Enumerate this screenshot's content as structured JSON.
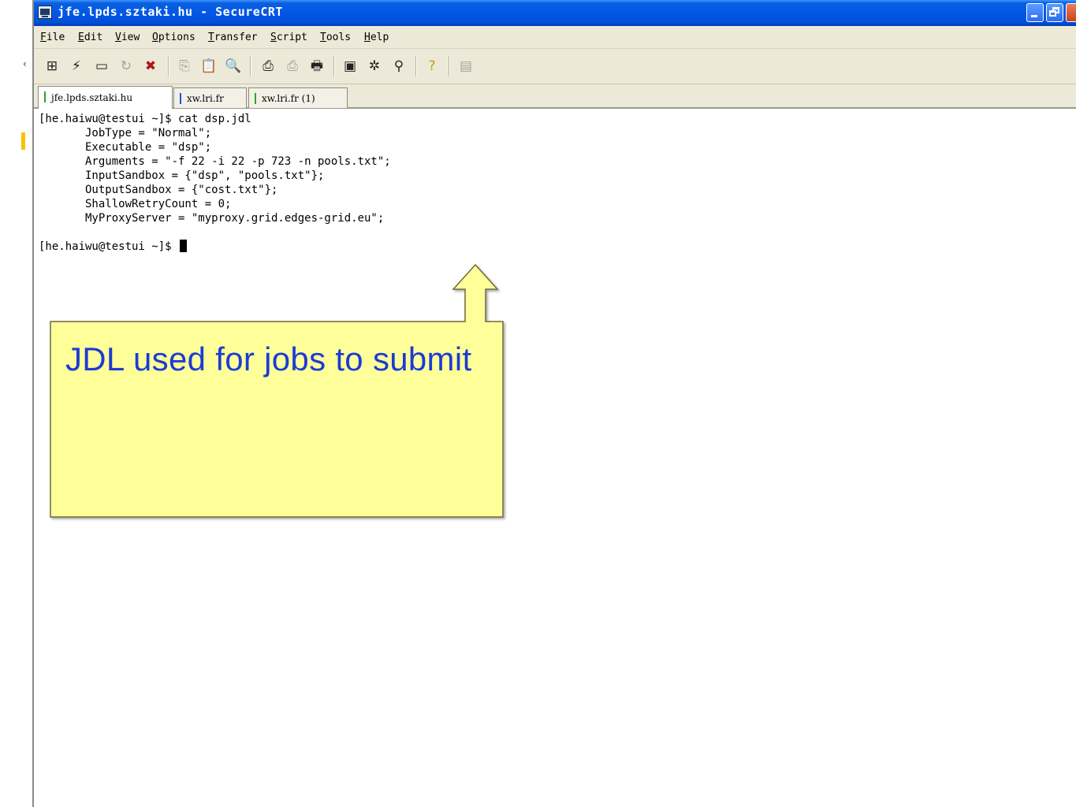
{
  "window": {
    "title": "jfe.lpds.sztaki.hu - SecureCRT"
  },
  "menu": {
    "items": [
      "File",
      "Edit",
      "View",
      "Options",
      "Transfer",
      "Script",
      "Tools",
      "Help"
    ]
  },
  "toolbar": {
    "icons": [
      "connect-icon",
      "quick-connect-icon",
      "connect-in-tab-icon",
      "reconnect-icon",
      "disconnect-icon",
      "copy-icon",
      "paste-icon",
      "find-icon",
      "print-icon",
      "print-selection-icon",
      "print-setup-icon",
      "session-options-icon",
      "global-options-icon",
      "keymap-icon",
      "help-icon",
      "log-icon"
    ]
  },
  "tabs": [
    {
      "label": "jfe.lpds.sztaki.hu",
      "active": true,
      "marker_color": "#2aa62a"
    },
    {
      "label": "xw.lri.fr",
      "active": false,
      "marker_color": "#1f4fe0"
    },
    {
      "label": "xw.lri.fr (1)",
      "active": false,
      "marker_color": "#2aa62a"
    }
  ],
  "terminal": {
    "lines": [
      "[he.haiwu@testui ~]$ cat dsp.jdl",
      "       JobType = \"Normal\";",
      "       Executable = \"dsp\";",
      "       Arguments = \"-f 22 -i 22 -p 723 -n pools.txt\";",
      "       InputSandbox = {\"dsp\", \"pools.txt\"};",
      "       OutputSandbox = {\"cost.txt\"};",
      "       ShallowRetryCount = 0;",
      "       MyProxyServer = \"myproxy.grid.edges-grid.eu\";",
      "",
      "[he.haiwu@testui ~]$ "
    ]
  },
  "callout": {
    "text": "JDL used for jobs to submit",
    "fill_color": "#ffff99",
    "text_color": "#1c3bd6"
  },
  "colors": {
    "titlebar": "#0058e6",
    "chrome": "#ece9d8",
    "gutter_marker": "#f6c200"
  }
}
